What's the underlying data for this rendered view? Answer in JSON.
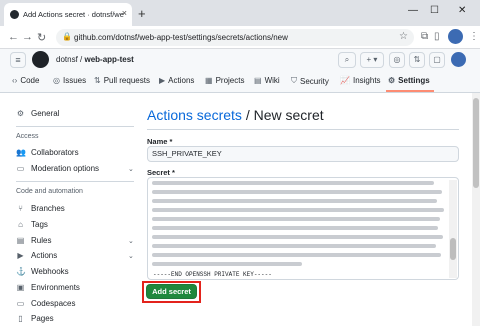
{
  "browser": {
    "tab_title": "Add Actions secret · dotnsf/we",
    "tab_close": "×",
    "new_tab": "+",
    "url": "github.com/dotnsf/web-app-test/settings/secrets/actions/new",
    "min": "—",
    "max": "☐",
    "close": "✕"
  },
  "header": {
    "owner": "dotnsf",
    "separator": "/",
    "repo": "web-app-test"
  },
  "repo_nav": [
    {
      "icon": "code-icon",
      "glyph": "‹›",
      "label": "Code"
    },
    {
      "icon": "issues-icon",
      "glyph": "◎",
      "label": "Issues"
    },
    {
      "icon": "pull-request-icon",
      "glyph": "⇅",
      "label": "Pull requests"
    },
    {
      "icon": "actions-icon",
      "glyph": "▶",
      "label": "Actions"
    },
    {
      "icon": "projects-icon",
      "glyph": "▦",
      "label": "Projects"
    },
    {
      "icon": "wiki-icon",
      "glyph": "▤",
      "label": "Wiki"
    },
    {
      "icon": "security-icon",
      "glyph": "⛉",
      "label": "Security"
    },
    {
      "icon": "insights-icon",
      "glyph": "📈",
      "label": "Insights"
    },
    {
      "icon": "settings-icon",
      "glyph": "⚙",
      "label": "Settings"
    }
  ],
  "sidebar": {
    "general": "General",
    "access_heading": "Access",
    "collaborators": "Collaborators",
    "moderation": "Moderation options",
    "code_heading": "Code and automation",
    "branches": "Branches",
    "tags": "Tags",
    "rules": "Rules",
    "actions": "Actions",
    "webhooks": "Webhooks",
    "environments": "Environments",
    "codespaces": "Codespaces",
    "pages": "Pages"
  },
  "main": {
    "title_link": "Actions secrets",
    "title_rest": " / New secret",
    "name_label": "Name *",
    "name_value": "SSH_PRIVATE_KEY",
    "secret_label": "Secret *",
    "secret_end": "-----END OPENSSH PRIVATE KEY-----",
    "add_button": "Add secret"
  }
}
